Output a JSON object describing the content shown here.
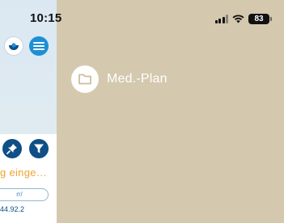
{
  "status_bar": {
    "time": "10:15",
    "battery": "83"
  },
  "sidebar": {
    "partial_text": "g einge…",
    "pill_text": "rr/",
    "bottom_text": "44.92.2"
  },
  "menu": {
    "items": [
      {
        "label": "Med.-Plan",
        "icon": "folder-icon"
      }
    ]
  },
  "colors": {
    "background": "#d4c8ae",
    "accent_blue": "#1e8fd6",
    "dark_blue": "#0d4f86",
    "orange": "#f0a430"
  }
}
